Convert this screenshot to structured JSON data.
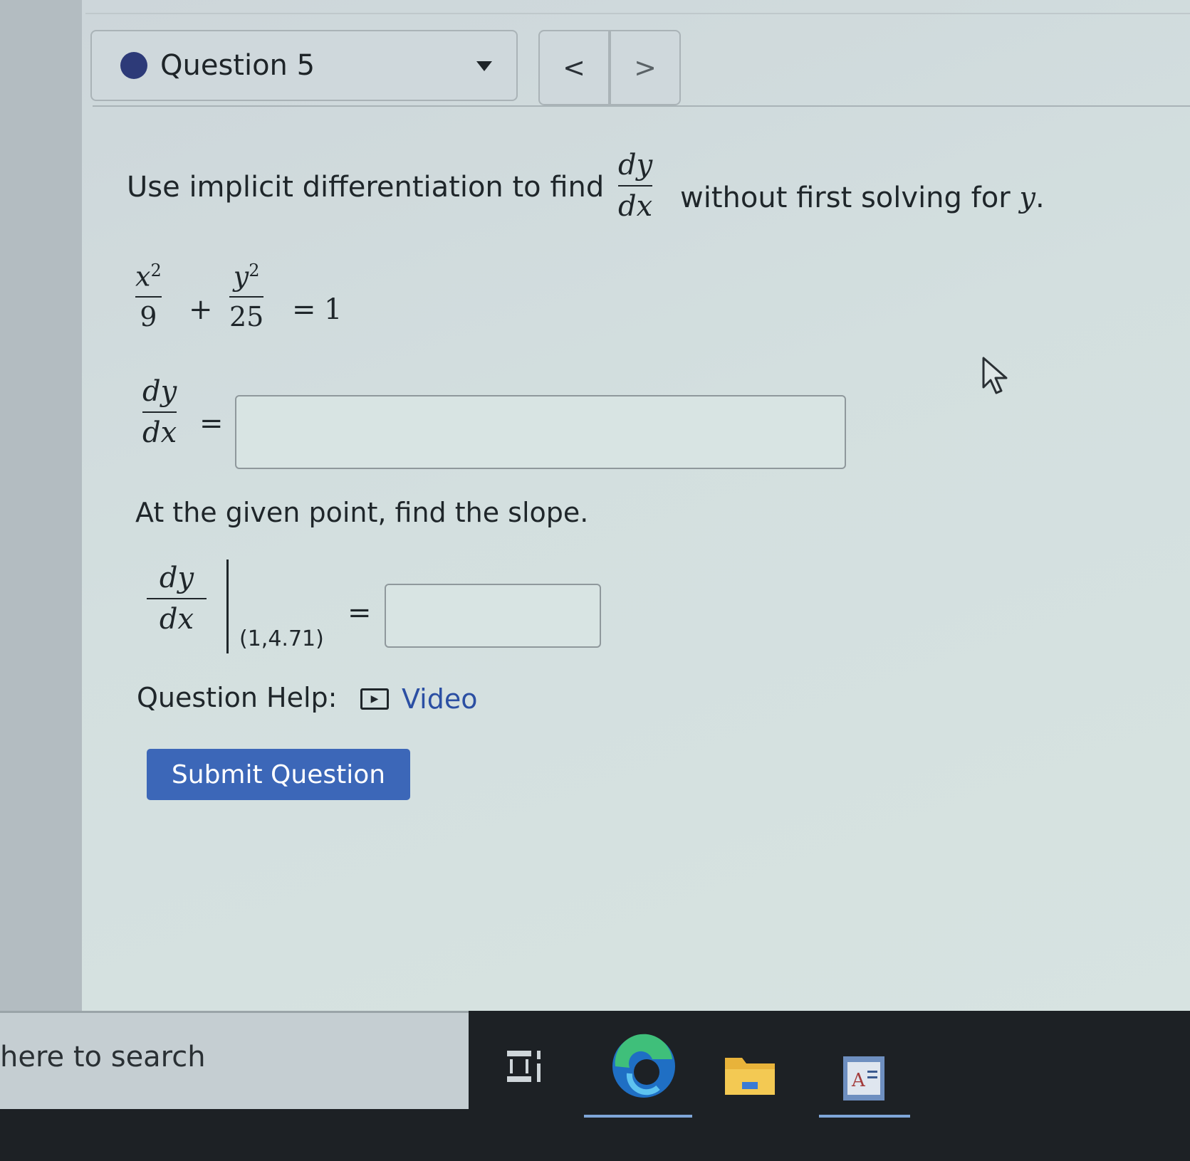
{
  "header": {
    "question_label": "Question 5",
    "prev_label": "<",
    "next_label": ">"
  },
  "question": {
    "prompt_before": "Use implicit differentiation to find",
    "prompt_after": "without first solving for",
    "prompt_var": "y",
    "prompt_end": ".",
    "dy": "dy",
    "dx": "dx",
    "equation": {
      "term1_num": "x",
      "term1_exp": "2",
      "term1_den": "9",
      "plus": "+",
      "term2_num": "y",
      "term2_exp": "2",
      "term2_den": "25",
      "equals": "=",
      "rhs": "1"
    },
    "slope_prompt": "At the given point, find the slope.",
    "point": "(1,4.71)",
    "answer1_value": "",
    "answer2_value": ""
  },
  "help": {
    "label": "Question Help:",
    "video_label": "Video"
  },
  "submit_label": "Submit Question",
  "taskbar": {
    "search_text": "here to search",
    "icons": [
      "task-view-icon",
      "edge-browser-icon",
      "file-explorer-icon",
      "word-app-icon"
    ]
  },
  "colors": {
    "accent_button": "#3c67b8",
    "link": "#2b4fa3",
    "question_dot": "#2d3a78"
  }
}
